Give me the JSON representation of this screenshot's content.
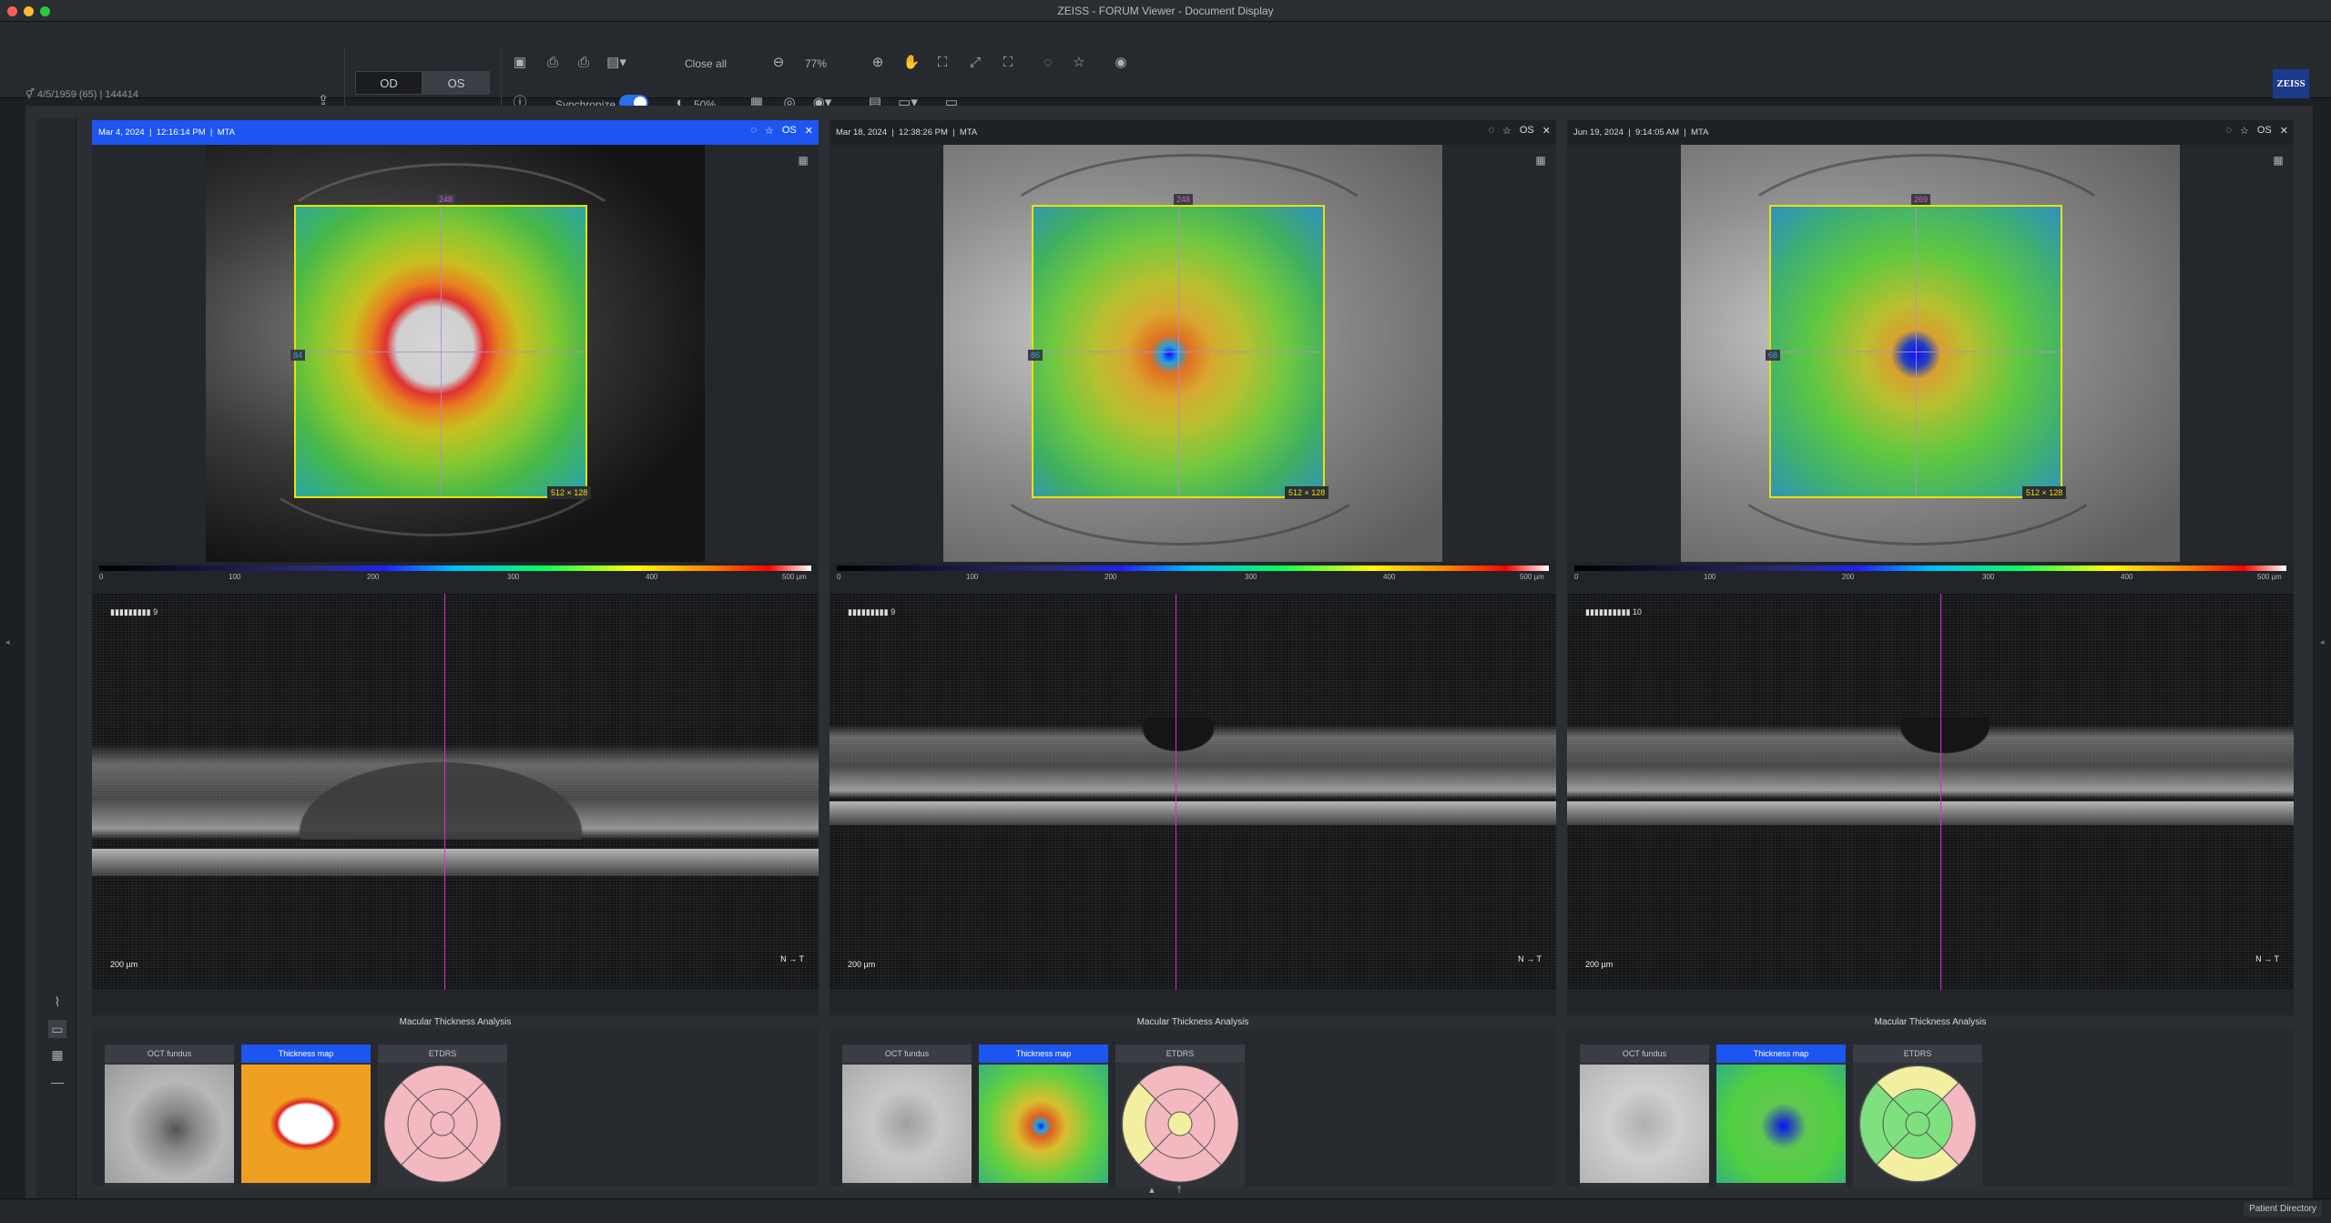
{
  "window": {
    "title": "ZEISS - FORUM Viewer - Document Display"
  },
  "patient": {
    "dob_age": "4/5/1959 (65)",
    "id": "144414"
  },
  "eyes": {
    "od": "OD",
    "os": "OS",
    "selected": "OS"
  },
  "toolbar": {
    "close_all": "Close all",
    "zoom": "77%",
    "synchronize": "Synchronize",
    "opacity": "50%"
  },
  "brand": {
    "logo": "ZEISS",
    "color": "#1b3a8c"
  },
  "panels": [
    {
      "date": "Mar 4, 2024",
      "time": "12:16:14 PM",
      "type": "MTA",
      "eye": "OS",
      "active": true,
      "top_value": "248",
      "left_value": "84",
      "dims": "512 × 128",
      "quality": "9",
      "scale": "200 µm",
      "orient": "N → T"
    },
    {
      "date": "Mar 18, 2024",
      "time": "12:38:26 PM",
      "type": "MTA",
      "eye": "OS",
      "active": false,
      "top_value": "248",
      "left_value": "86",
      "dims": "512 × 128",
      "quality": "9",
      "scale": "200 µm",
      "orient": "N → T"
    },
    {
      "date": "Jun 19, 2024",
      "time": "9:14:05 AM",
      "type": "MTA",
      "eye": "OS",
      "active": false,
      "top_value": "269",
      "left_value": "68",
      "dims": "512 × 128",
      "quality": "10",
      "scale": "200 µm",
      "orient": "N → T"
    }
  ],
  "scale_ticks": [
    "0",
    "100",
    "200",
    "300",
    "400",
    "500 µm"
  ],
  "analysis": {
    "title": "Macular Thickness Analysis",
    "tabs": [
      "OCT fundus",
      "Thickness map",
      "ETDRS"
    ],
    "selected_tab": "Thickness map"
  },
  "footer": {
    "patient_directory": "Patient Directory"
  }
}
